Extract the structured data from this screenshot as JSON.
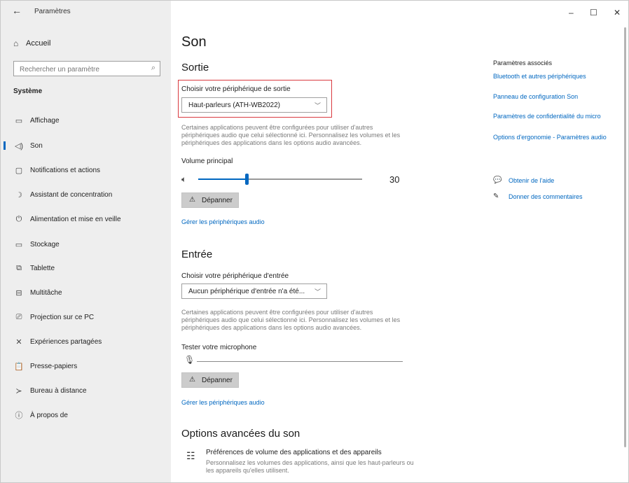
{
  "window": {
    "title": "Paramètres",
    "controls": {
      "minimize": "–",
      "maximize": "☐",
      "close": "✕"
    }
  },
  "sidebar": {
    "back_icon": "←",
    "home": {
      "icon": "⌂",
      "label": "Accueil"
    },
    "search": {
      "placeholder": "Rechercher un paramètre",
      "icon": "⌕"
    },
    "section": "Système",
    "items": [
      {
        "icon": "▭",
        "label": "Affichage"
      },
      {
        "icon": "◁)",
        "label": "Son"
      },
      {
        "icon": "▢",
        "label": "Notifications et actions"
      },
      {
        "icon": "☽",
        "label": "Assistant de concentration"
      },
      {
        "icon": "⏻",
        "label": "Alimentation et mise en veille"
      },
      {
        "icon": "▭",
        "label": "Stockage"
      },
      {
        "icon": "⧉",
        "label": "Tablette"
      },
      {
        "icon": "⊟",
        "label": "Multitâche"
      },
      {
        "icon": "⎚",
        "label": "Projection sur ce PC"
      },
      {
        "icon": "✕",
        "label": "Expériences partagées"
      },
      {
        "icon": "📋",
        "label": "Presse-papiers"
      },
      {
        "icon": "≻",
        "label": "Bureau à distance"
      },
      {
        "icon": "ⓘ",
        "label": "À propos de"
      }
    ],
    "active_index": 1,
    "accent": "#0067c0"
  },
  "main": {
    "title": "Son",
    "output": {
      "heading": "Sortie",
      "device_label": "Choisir votre périphérique de sortie",
      "device_value": "Haut-parleurs (ATH-WB2022)",
      "description": "Certaines applications peuvent être configurées pour utiliser d'autres périphériques audio que celui sélectionné ici. Personnalisez les volumes et les périphériques des applications dans les options audio avancées.",
      "volume_label": "Volume principal",
      "volume_value": "30",
      "troubleshoot": "Dépanner",
      "manage_link": "Gérer les périphériques audio"
    },
    "input": {
      "heading": "Entrée",
      "device_label": "Choisir votre périphérique d'entrée",
      "device_value": "Aucun périphérique d'entrée n'a été...",
      "description": "Certaines applications peuvent être configurées pour utiliser d'autres périphériques audio que celui sélectionné ici. Personnalisez les volumes et les périphériques des applications dans les options audio avancées.",
      "test_label": "Tester votre microphone",
      "troubleshoot": "Dépanner",
      "manage_link": "Gérer les périphériques audio"
    },
    "advanced": {
      "heading": "Options avancées du son",
      "item_title": "Préférences de volume des applications et des appareils",
      "item_desc": "Personnalisez les volumes des applications, ainsi que les haut-parleurs ou les appareils qu'elles utilisent."
    }
  },
  "related": {
    "title": "Paramètres associés",
    "links": [
      "Bluetooth et autres périphériques",
      "Panneau de configuration Son",
      "Paramètres de confidentialité du micro",
      "Options d'ergonomie - Paramètres audio"
    ],
    "help": {
      "label": "Obtenir de l'aide",
      "icon": "💬"
    },
    "feedback": {
      "label": "Donner des commentaires",
      "icon": "✎"
    }
  }
}
